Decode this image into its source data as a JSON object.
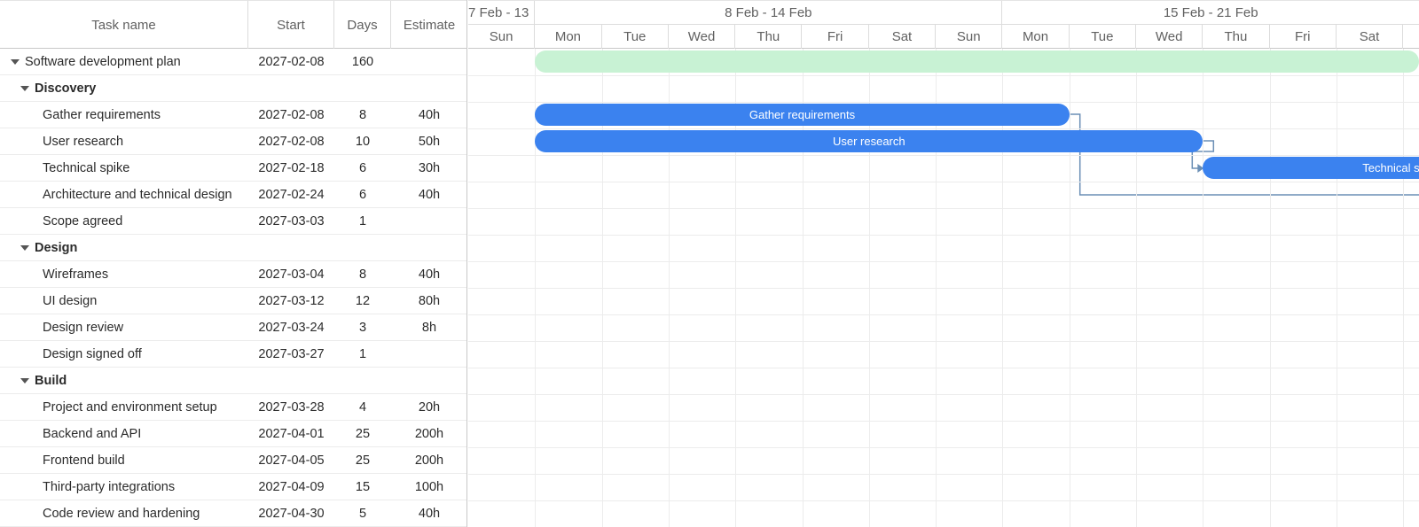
{
  "columns": {
    "task_name": "Task name",
    "start": "Start",
    "days": "Days",
    "estimate": "Estimate"
  },
  "weeks": [
    {
      "label": "7 Feb - 13"
    },
    {
      "label": "8 Feb - 14 Feb"
    },
    {
      "label": "15 Feb - 21 Feb"
    }
  ],
  "days": [
    "Sun",
    "Mon",
    "Tue",
    "Wed",
    "Thu",
    "Fri",
    "Sat",
    "Sun",
    "Mon",
    "Tue",
    "Wed",
    "Thu",
    "Fri",
    "Sat"
  ],
  "rows": [
    {
      "name": "Software development plan",
      "start": "2027-02-08",
      "days": "160",
      "estimate": "",
      "level": 0
    },
    {
      "name": "Discovery",
      "start": "",
      "days": "",
      "estimate": "",
      "level": 1
    },
    {
      "name": "Gather requirements",
      "start": "2027-02-08",
      "days": "8",
      "estimate": "40h",
      "level": 2
    },
    {
      "name": "User research",
      "start": "2027-02-08",
      "days": "10",
      "estimate": "50h",
      "level": 2
    },
    {
      "name": "Technical spike",
      "start": "2027-02-18",
      "days": "6",
      "estimate": "30h",
      "level": 2
    },
    {
      "name": "Architecture and technical design",
      "start": "2027-02-24",
      "days": "6",
      "estimate": "40h",
      "level": 2
    },
    {
      "name": "Scope agreed",
      "start": "2027-03-03",
      "days": "1",
      "estimate": "",
      "level": 2
    },
    {
      "name": "Design",
      "start": "",
      "days": "",
      "estimate": "",
      "level": 1
    },
    {
      "name": "Wireframes",
      "start": "2027-03-04",
      "days": "8",
      "estimate": "40h",
      "level": 2
    },
    {
      "name": "UI design",
      "start": "2027-03-12",
      "days": "12",
      "estimate": "80h",
      "level": 2
    },
    {
      "name": "Design review",
      "start": "2027-03-24",
      "days": "3",
      "estimate": "8h",
      "level": 2
    },
    {
      "name": "Design signed off",
      "start": "2027-03-27",
      "days": "1",
      "estimate": "",
      "level": 2
    },
    {
      "name": "Build",
      "start": "",
      "days": "",
      "estimate": "",
      "level": 1
    },
    {
      "name": "Project and environment setup",
      "start": "2027-03-28",
      "days": "4",
      "estimate": "20h",
      "level": 2
    },
    {
      "name": "Backend and API",
      "start": "2027-04-01",
      "days": "25",
      "estimate": "200h",
      "level": 2
    },
    {
      "name": "Frontend build",
      "start": "2027-04-05",
      "days": "25",
      "estimate": "200h",
      "level": 2
    },
    {
      "name": "Third-party integrations",
      "start": "2027-04-09",
      "days": "15",
      "estimate": "100h",
      "level": 2
    },
    {
      "name": "Code review and hardening",
      "start": "2027-04-30",
      "days": "5",
      "estimate": "40h",
      "level": 2
    }
  ],
  "bars": [
    {
      "row": 0,
      "type": "summary",
      "label": ""
    },
    {
      "row": 2,
      "type": "task",
      "label": "Gather requirements"
    },
    {
      "row": 3,
      "type": "task",
      "label": "User research"
    },
    {
      "row": 4,
      "type": "task",
      "label": "Technical s"
    }
  ],
  "colors": {
    "task_bar": "#3b82ef",
    "summary_bar": "#c8f2d4",
    "link_line": "#6b8fb5"
  }
}
